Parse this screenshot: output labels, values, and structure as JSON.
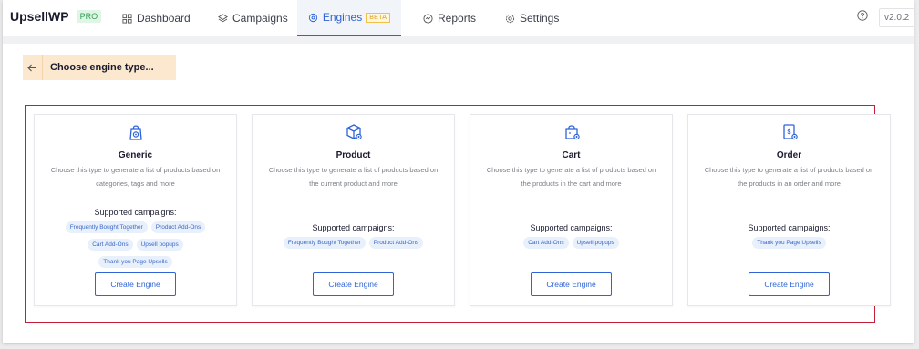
{
  "app": {
    "brand": "UpsellWP",
    "badge": "PRO",
    "version": "v2.0.2"
  },
  "nav": [
    {
      "label": "Dashboard",
      "icon": "dashboard-icon"
    },
    {
      "label": "Campaigns",
      "icon": "layers-icon"
    },
    {
      "label": "Engines",
      "icon": "engine-icon",
      "badge": "BETA",
      "active": true
    },
    {
      "label": "Reports",
      "icon": "reports-icon"
    },
    {
      "label": "Settings",
      "icon": "gear-icon"
    }
  ],
  "header": {
    "title": "Choose engine type..."
  },
  "cards": [
    {
      "title": "Generic",
      "icon": "bag-target-icon",
      "description": "Choose this type to generate a list of products based on categories, tags and more",
      "supported_label": "Supported campaigns:",
      "tags": [
        "Frequently Bought Together",
        "Product Add-Ons",
        "Cart Add-Ons",
        "Upsell popups",
        "Thank you Page Upsells"
      ],
      "button": "Create Engine"
    },
    {
      "title": "Product",
      "icon": "box-icon",
      "description": "Choose this type to generate a list of products based on the current product and more",
      "supported_label": "Supported campaigns:",
      "tags": [
        "Frequently Bought Together",
        "Product Add-Ons"
      ],
      "button": "Create Engine"
    },
    {
      "title": "Cart",
      "icon": "cart-bag-icon",
      "description": "Choose this type to generate a list of products based on the products in the cart and more",
      "supported_label": "Supported campaigns:",
      "tags": [
        "Cart Add-Ons",
        "Upsell popups"
      ],
      "button": "Create Engine"
    },
    {
      "title": "Order",
      "icon": "receipt-icon",
      "description": "Choose this type to generate a list of products based on the products in an order and more",
      "supported_label": "Supported campaigns:",
      "tags": [
        "Thank you Page Upsells"
      ],
      "button": "Create Engine"
    }
  ],
  "colors": {
    "accent": "#2f63d6",
    "highlight": "#fbe8cf",
    "frame": "#c0203a"
  }
}
